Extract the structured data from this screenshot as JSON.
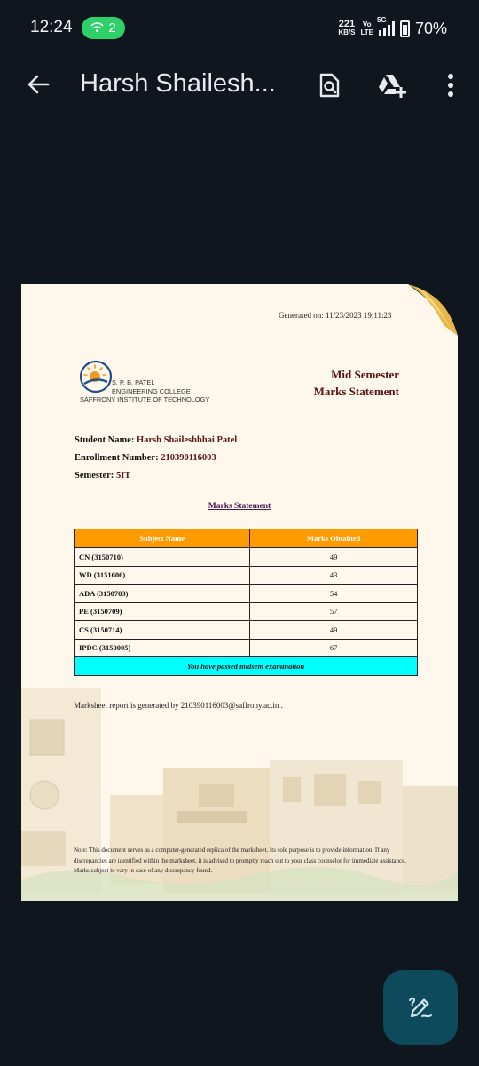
{
  "status_bar": {
    "time": "12:24",
    "hotspot_count": "2",
    "speed_value": "221",
    "speed_unit": "KB/S",
    "volte_top": "Vo",
    "volte_bottom": "LTE",
    "network": "5G",
    "battery": "70%",
    "hotspot_color": "#2fcf6a"
  },
  "app_bar": {
    "title": "Harsh Shailesh...",
    "icons": [
      "back-arrow-icon",
      "document-search-icon",
      "drive-add-icon",
      "more-vert-icon"
    ]
  },
  "document": {
    "generated_on": "Generated on: 11/23/2023 19:11:23",
    "college": {
      "line1": "S. P. B. PATEL",
      "line2": "ENGINEERING COLLEGE",
      "line3": "SAFFRONY INSTITUTE OF TECHNOLOGY"
    },
    "heading": {
      "line1": "Mid Semester",
      "line2": "Marks Statement"
    },
    "student": {
      "name_label": "Student Name:",
      "name": "Harsh Shaileshbhai Patel",
      "enrollment_label": "Enrollment Number:",
      "enrollment": "210390116003",
      "semester_label": "Semester:",
      "semester": "5IT"
    },
    "statement_title": "Marks Statement",
    "table": {
      "headers": [
        "Subject Name",
        "Marks Obtained"
      ],
      "rows": [
        {
          "subject": "CN (3150710)",
          "marks": "49"
        },
        {
          "subject": "WD (3151606)",
          "marks": "43"
        },
        {
          "subject": "ADA (3150703)",
          "marks": "54"
        },
        {
          "subject": "PE (3150709)",
          "marks": "57"
        },
        {
          "subject": "CS (3150714)",
          "marks": "49"
        },
        {
          "subject": "IPDC (3150005)",
          "marks": "67"
        }
      ],
      "result": "You have passed midsem examination",
      "header_color": "#ff9a00",
      "result_color": "#00ffff"
    },
    "report_line": "Marksheet report is generated by 210390116003@saffrony.ac.in .",
    "note": "Note: This document serves as a computer-generated replica of the marksheet. Its sole purpose is to provide information. If any discrepancies are identified within the marksheet, it is advised to promptly reach out to your class counselor for immediate assistance. Marks subject to vary in case of any discrepancy found."
  },
  "fab": {
    "icon": "edit-pen-icon"
  }
}
